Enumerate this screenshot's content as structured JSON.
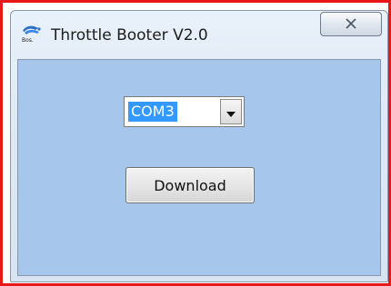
{
  "window": {
    "title": "Throttle Booter V2.0",
    "icon": "app-logo-icon",
    "close_icon": "close-icon"
  },
  "form": {
    "port_select": {
      "selected": "COM3",
      "dropdown_icon": "chevron-down-icon"
    },
    "download_label": "Download"
  },
  "colors": {
    "highlight_border": "#e8171a",
    "client_background": "#a6c6ec",
    "selection": "#3399ff"
  }
}
